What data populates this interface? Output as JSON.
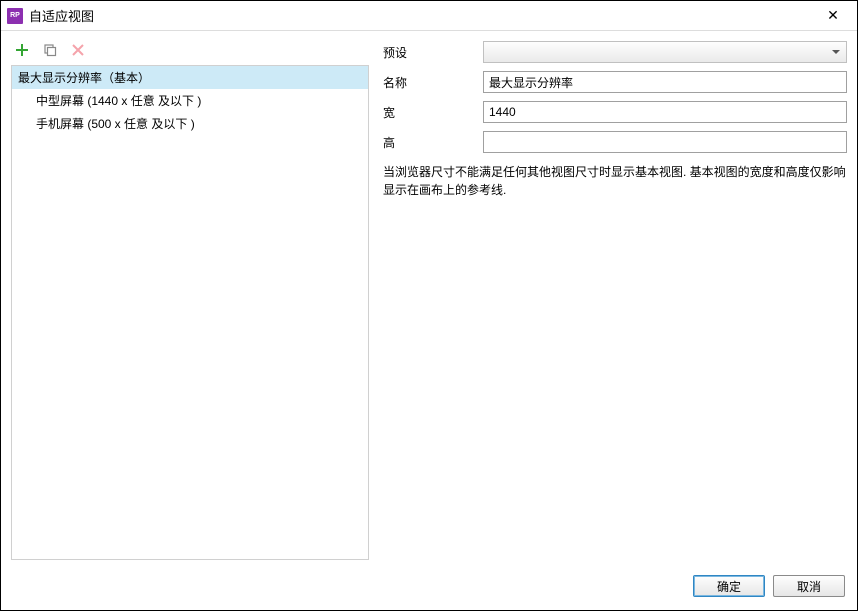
{
  "window": {
    "app_icon_text": "RP",
    "title": "自适应视图"
  },
  "list": {
    "items": [
      {
        "label": "最大显示分辨率（基本）",
        "indent": 0,
        "selected": true
      },
      {
        "label": "中型屏幕 (1440 x 任意  及以下 )",
        "indent": 1,
        "selected": false
      },
      {
        "label": "手机屏幕 (500 x 任意  及以下 )",
        "indent": 1,
        "selected": false
      }
    ]
  },
  "form": {
    "preset_label": "预设",
    "preset_value": "",
    "name_label": "名称",
    "name_value": "最大显示分辨率",
    "width_label": "宽",
    "width_value": "1440",
    "height_label": "高",
    "height_value": "",
    "help_text": "当浏览器尺寸不能满足任何其他视图尺寸时显示基本视图. 基本视图的宽度和高度仅影响显示在画布上的参考线."
  },
  "footer": {
    "ok": "确定",
    "cancel": "取消"
  }
}
